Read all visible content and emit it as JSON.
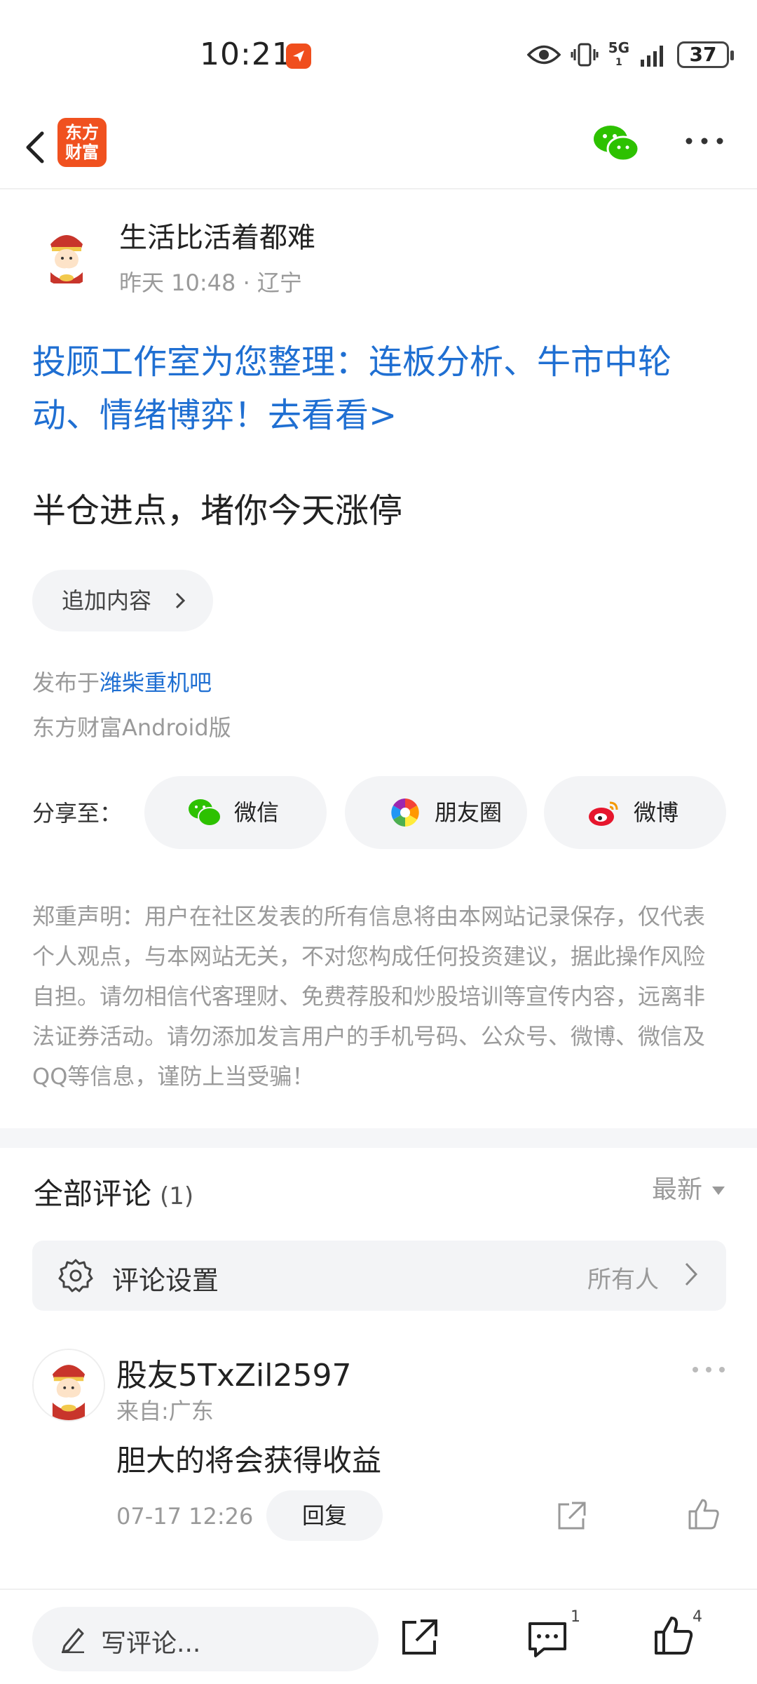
{
  "status_bar": {
    "time": "10:21",
    "battery": "37",
    "network": "5G"
  },
  "header": {
    "logo_text_line1": "东方",
    "logo_text_line2": "财富"
  },
  "post": {
    "author": "生活比活着都难",
    "meta": "昨天 10:48 · 辽宁",
    "promo_link": "投顾工作室为您整理：连板分析、牛市中轮动、情绪博弈！去看看>",
    "content": "半仓进点，堵你今天涨停",
    "add_content_label": "追加内容",
    "published_prefix": "发布于",
    "bar_name": "潍柴重机吧",
    "client": "东方财富Android版"
  },
  "share": {
    "label": "分享至：",
    "wechat": "微信",
    "moments": "朋友圈",
    "weibo": "微博"
  },
  "disclaimer": "郑重声明：用户在社区发表的所有信息将由本网站记录保存，仅代表个人观点，与本网站无关，不对您构成任何投资建议，据此操作风险自担。请勿相信代客理财、免费荐股和炒股培训等宣传内容，远离非法证券活动。请勿添加发言用户的手机号码、公众号、微博、微信及QQ等信息，谨防上当受骗！",
  "comments": {
    "title": "全部评论",
    "count": "(1)",
    "sort": "最新",
    "settings_label": "评论设置",
    "settings_value": "所有人",
    "items": [
      {
        "user": "股友5TxZil2597",
        "location": "来自:广东",
        "text": "胆大的将会获得收益",
        "time": "07-17 12:26",
        "reply_label": "回复"
      }
    ]
  },
  "bottom_bar": {
    "write_placeholder": "写评论...",
    "comment_count": "1",
    "like_count": "4"
  },
  "colors": {
    "brand": "#f0511f",
    "link": "#1f6fd2",
    "wechat_green": "#2dc100"
  }
}
